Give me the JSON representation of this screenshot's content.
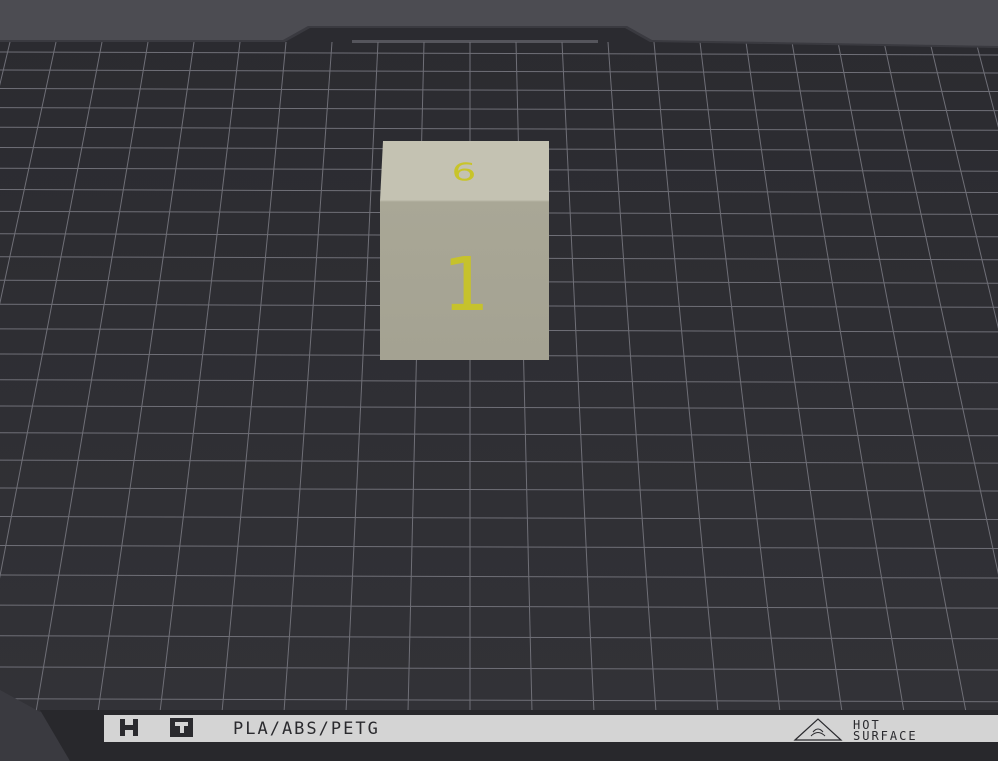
{
  "scene": {
    "bed_label": {
      "material_text": "PLA/ABS/PETG",
      "warning_line1": "HOT",
      "warning_line2": "SURFACE"
    },
    "cube": {
      "top_face_number": "6",
      "front_face_number": "1",
      "face_color": "#a8a696",
      "top_color": "#c3c1b1",
      "number_color": "#c8c42a"
    },
    "colors": {
      "background": "#4c4c52",
      "bed": "#2f2f34",
      "grid": "#707078",
      "label_strip": "#d6d6d6",
      "label_text": "#2a2a2e"
    },
    "icons": {
      "logo": "brand-logo-icon",
      "warning": "warning-triangle-icon"
    }
  }
}
